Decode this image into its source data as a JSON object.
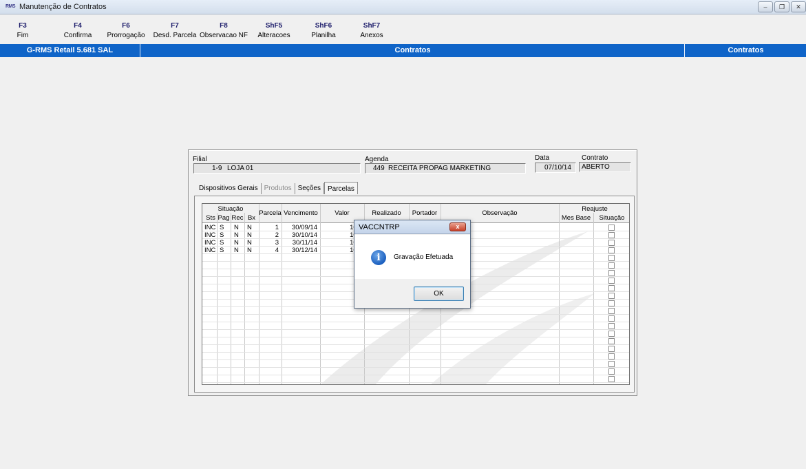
{
  "window": {
    "title": "Manutenção de Contratos",
    "logo_text": "RMS"
  },
  "fkeys": [
    {
      "key": "F3",
      "label": "Fim"
    },
    {
      "key": "F4",
      "label": "Confirma"
    },
    {
      "key": "F6",
      "label": "Prorrogação"
    },
    {
      "key": "F7",
      "label": "Desd. Parcela"
    },
    {
      "key": "F8",
      "label": "Observacao NF"
    },
    {
      "key": "ShF5",
      "label": "Alteracoes"
    },
    {
      "key": "ShF6",
      "label": "Planilha"
    },
    {
      "key": "ShF7",
      "label": "Anexos"
    }
  ],
  "statusbar": {
    "left": "G-RMS Retail 5.681 SAL",
    "middle": "Contratos",
    "right": "Contratos"
  },
  "form": {
    "filial_label": "Filial",
    "filial_code": "1-9",
    "filial_name": "LOJA 01",
    "agenda_label": "Agenda",
    "agenda_code": "449",
    "agenda_name": "RECEITA PROPAG MARKETING",
    "data_label": "Data",
    "data_value": "07/10/14",
    "contrato_label": "Contrato",
    "contrato_value": "ABERTO"
  },
  "tabs": [
    {
      "label": "Dispositivos Gerais",
      "state": "normal"
    },
    {
      "label": "Produtos",
      "state": "disabled"
    },
    {
      "label": "Seções",
      "state": "normal"
    },
    {
      "label": "Parcelas",
      "state": "active"
    }
  ],
  "grid": {
    "group_situacao": "Situação",
    "group_reajuste": "Reajuste",
    "headers": {
      "sts": "Sts",
      "pag": "Pag",
      "rec": "Rec",
      "bx": "Bx",
      "parcela": "Parcela",
      "vencimento": "Vencimento",
      "valor": "Valor",
      "realizado": "Realizado",
      "portador": "Portador",
      "observacao": "Observação",
      "mes_base": "Mes Base",
      "situacao": "Situação"
    },
    "rows": [
      {
        "sts": "INC",
        "pag": "S",
        "rec": "N",
        "bx": "N",
        "parcela": "1",
        "vencimento": "30/09/14",
        "valor": "100"
      },
      {
        "sts": "INC",
        "pag": "S",
        "rec": "N",
        "bx": "N",
        "parcela": "2",
        "vencimento": "30/10/14",
        "valor": "100"
      },
      {
        "sts": "INC",
        "pag": "S",
        "rec": "N",
        "bx": "N",
        "parcela": "3",
        "vencimento": "30/11/14",
        "valor": "100"
      },
      {
        "sts": "INC",
        "pag": "S",
        "rec": "N",
        "bx": "N",
        "parcela": "4",
        "vencimento": "30/12/14",
        "valor": "100"
      }
    ]
  },
  "dialog": {
    "title": "VACCNTRP",
    "message": "Gravação Efetuada",
    "ok_label": "OK",
    "close_glyph": "x"
  }
}
